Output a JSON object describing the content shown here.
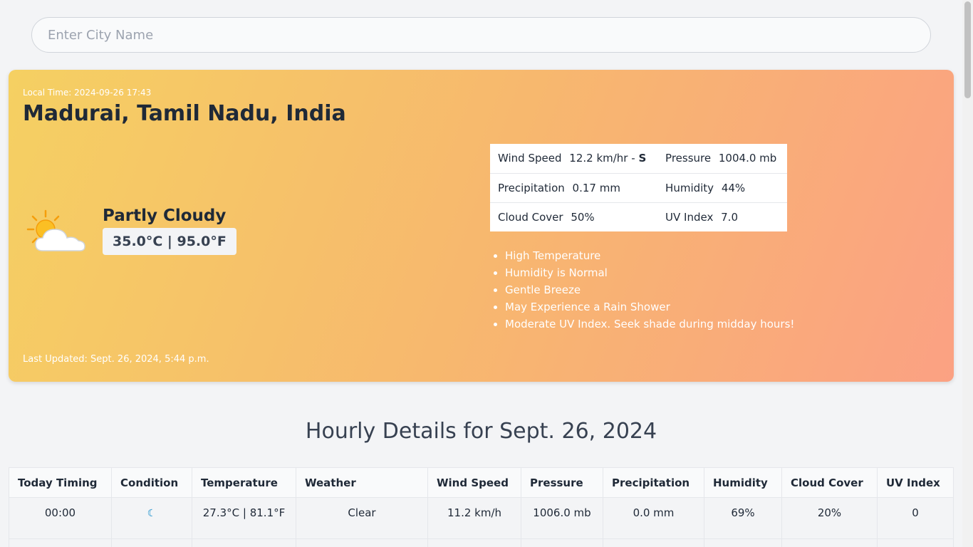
{
  "search": {
    "placeholder": "Enter City Name"
  },
  "current": {
    "local_time": "Local Time: 2024-09-26 17:43",
    "location": "Madurai, Tamil Nadu, India",
    "condition": "Partly Cloudy",
    "condition_icon": "partly-cloudy-icon",
    "temperature": "35.0°C | 95.0°F",
    "last_updated": "Last Updated: Sept. 26, 2024, 5:44 p.m.",
    "stats": {
      "wind_label": "Wind Speed",
      "wind_value": "12.2 km/hr - ",
      "wind_dir": "S",
      "pressure_label": "Pressure",
      "pressure_value": "1004.0 mb",
      "precip_label": "Precipitation",
      "precip_value": "0.17 mm",
      "humidity_label": "Humidity",
      "humidity_value": "44%",
      "cloud_label": "Cloud Cover",
      "cloud_value": "50%",
      "uv_label": "UV Index",
      "uv_value": "7.0"
    },
    "advice": [
      "High Temperature",
      "Humidity is Normal",
      "Gentle Breeze",
      "May Experience a Rain Shower",
      "Moderate UV Index. Seek shade during midday hours!"
    ]
  },
  "hourly": {
    "title": "Hourly Details for Sept. 26, 2024",
    "headers": [
      "Today Timing",
      "Condition",
      "Temperature",
      "Weather",
      "Wind Speed",
      "Pressure",
      "Precipitation",
      "Humidity",
      "Cloud Cover",
      "UV Index"
    ],
    "rows": [
      {
        "time": "00:00",
        "icon": "moon-icon",
        "temp": "27.3°C | 81.1°F",
        "weather": "Clear",
        "wind": "11.2 km/h",
        "pressure": "1006.0 mb",
        "precip": "0.0 mm",
        "humidity": "69%",
        "cloud": "20%",
        "uv": "0"
      }
    ]
  },
  "colors": {
    "hero_start": "#f5d062",
    "hero_end": "#fba183",
    "moon": "#0284c7"
  }
}
